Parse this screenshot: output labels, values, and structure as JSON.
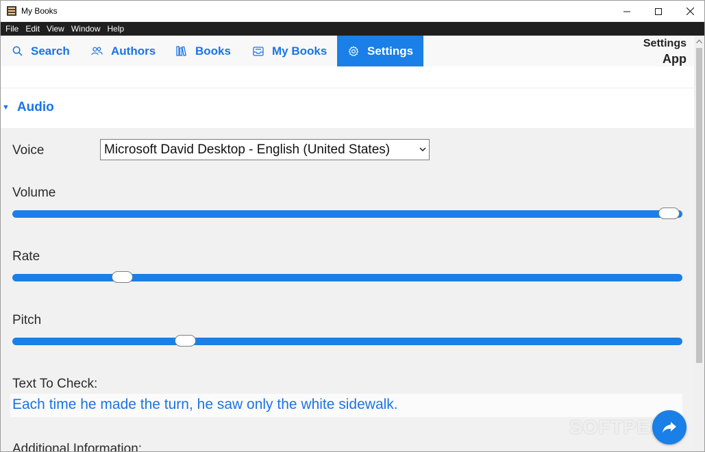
{
  "window": {
    "title": "My Books"
  },
  "menu": {
    "items": [
      "File",
      "Edit",
      "View",
      "Window",
      "Help"
    ]
  },
  "tabs": [
    {
      "label": "Search",
      "icon": "search-icon"
    },
    {
      "label": "Authors",
      "icon": "people-icon"
    },
    {
      "label": "Books",
      "icon": "books-icon"
    },
    {
      "label": "My Books",
      "icon": "inbox-icon"
    },
    {
      "label": "Settings",
      "icon": "gear-icon",
      "active": true
    }
  ],
  "header_right": {
    "line1": "Settings",
    "line2": "App"
  },
  "section": {
    "title": "Audio"
  },
  "voice": {
    "label": "Voice",
    "selected": "Microsoft David Desktop - English (United States)"
  },
  "volume": {
    "label": "Volume",
    "value_fraction": 0.98
  },
  "rate": {
    "label": "Rate",
    "value_fraction": 0.164
  },
  "pitch": {
    "label": "Pitch",
    "value_fraction": 0.258
  },
  "text_check": {
    "label": "Text To Check:",
    "value": "Each time he made the turn, he saw only the white sidewalk."
  },
  "additional": {
    "label": "Additional Information:"
  },
  "watermark": {
    "text": "SOFTPEDIA"
  },
  "colors": {
    "accent": "#1a7fe6",
    "link": "#1a73e8",
    "menubar": "#1f1f1f"
  }
}
